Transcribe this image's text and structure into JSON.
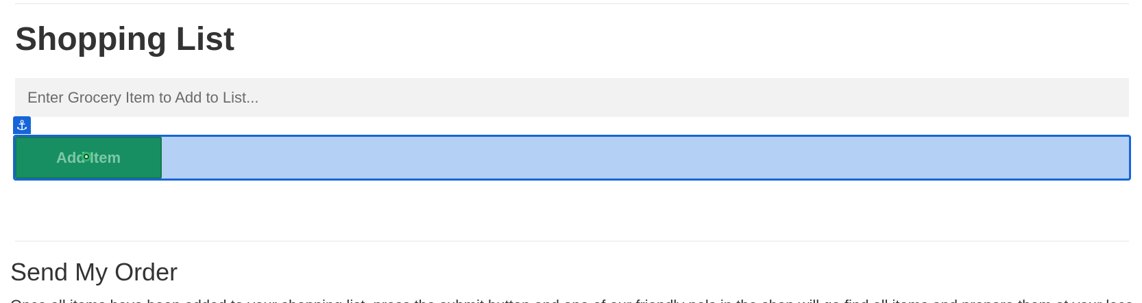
{
  "page": {
    "title": "Shopping List"
  },
  "grocery_input": {
    "placeholder": "Enter Grocery Item to Add to List...",
    "value": ""
  },
  "add_button": {
    "label": "Add Item"
  },
  "anchor_badge": {
    "icon": "anchor-icon",
    "glyph": "⚓"
  },
  "send_section": {
    "title": "Send My Order",
    "text": "Once all items have been added to your shopping list, press the submit button and one of our friendly pals in the shop will go find all items and prepare them at your local store."
  },
  "colors": {
    "button_bg": "#178f62",
    "highlight": "#1565d8",
    "input_bg": "#f2f2f2"
  }
}
